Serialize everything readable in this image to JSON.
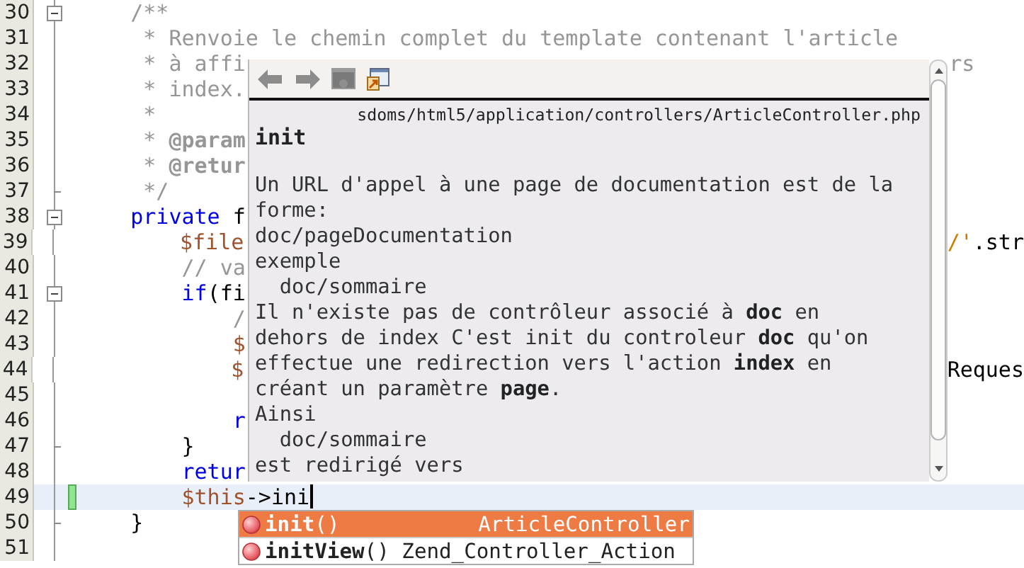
{
  "editor": {
    "lines": [
      {
        "number": "30",
        "fold_start": true,
        "fold_end": false,
        "changed": false,
        "current": false,
        "tokens": [
          {
            "text": "    /**",
            "kind": "comment"
          }
        ]
      },
      {
        "number": "31",
        "fold_start": false,
        "fold_end": false,
        "changed": false,
        "current": false,
        "tokens": [
          {
            "text": "     * Renvoie le chemin complet du template contenant l'article",
            "kind": "comment"
          }
        ]
      },
      {
        "number": "32",
        "fold_start": false,
        "fold_end": false,
        "changed": false,
        "current": false,
        "tokens": [
          {
            "text": "     * à affi",
            "kind": "comment"
          }
        ],
        "tail": [
          {
            "text": "rs",
            "kind": "comment"
          }
        ]
      },
      {
        "number": "33",
        "fold_start": false,
        "fold_end": false,
        "changed": false,
        "current": false,
        "tokens": [
          {
            "text": "     * index.",
            "kind": "comment"
          }
        ]
      },
      {
        "number": "34",
        "fold_start": false,
        "fold_end": false,
        "changed": false,
        "current": false,
        "tokens": [
          {
            "text": "     *",
            "kind": "comment"
          }
        ]
      },
      {
        "number": "35",
        "fold_start": false,
        "fold_end": false,
        "changed": false,
        "current": false,
        "tokens": [
          {
            "text": "     * ",
            "kind": "comment"
          },
          {
            "text": "@param",
            "kind": "doctag"
          }
        ]
      },
      {
        "number": "36",
        "fold_start": false,
        "fold_end": false,
        "changed": false,
        "current": false,
        "tokens": [
          {
            "text": "     * ",
            "kind": "comment"
          },
          {
            "text": "@retur",
            "kind": "doctag"
          }
        ]
      },
      {
        "number": "37",
        "fold_start": false,
        "fold_end": true,
        "changed": false,
        "current": false,
        "tokens": [
          {
            "text": "     */",
            "kind": "comment"
          }
        ]
      },
      {
        "number": "38",
        "fold_start": true,
        "fold_end": false,
        "changed": false,
        "current": false,
        "tokens": [
          {
            "text": "    private",
            "kind": "keyword"
          },
          {
            "text": " f",
            "kind": "plain"
          }
        ]
      },
      {
        "number": "39",
        "fold_start": false,
        "fold_end": false,
        "changed": false,
        "current": false,
        "tokens": [
          {
            "text": "        $file",
            "kind": "variable"
          }
        ],
        "tail": [
          {
            "text": "/'",
            "kind": "string"
          },
          {
            "text": ".str",
            "kind": "plain"
          }
        ]
      },
      {
        "number": "40",
        "fold_start": false,
        "fold_end": false,
        "changed": false,
        "current": false,
        "tokens": [
          {
            "text": "        // va",
            "kind": "comment"
          }
        ]
      },
      {
        "number": "41",
        "fold_start": true,
        "fold_end": false,
        "changed": false,
        "current": false,
        "tokens": [
          {
            "text": "        if",
            "kind": "keyword"
          },
          {
            "text": "(fi",
            "kind": "plain"
          }
        ]
      },
      {
        "number": "42",
        "fold_start": false,
        "fold_end": false,
        "changed": false,
        "current": false,
        "tokens": [
          {
            "text": "            /",
            "kind": "comment"
          }
        ]
      },
      {
        "number": "43",
        "fold_start": false,
        "fold_end": false,
        "changed": false,
        "current": false,
        "tokens": [
          {
            "text": "            $",
            "kind": "variable"
          }
        ]
      },
      {
        "number": "44",
        "fold_start": false,
        "fold_end": false,
        "changed": false,
        "current": false,
        "tokens": [
          {
            "text": "            $",
            "kind": "variable"
          }
        ],
        "tail": [
          {
            "text": "Reques",
            "kind": "plain"
          }
        ]
      },
      {
        "number": "45",
        "fold_start": false,
        "fold_end": false,
        "changed": false,
        "current": false
      },
      {
        "number": "46",
        "fold_start": false,
        "fold_end": false,
        "changed": false,
        "current": false,
        "tokens": [
          {
            "text": "            r",
            "kind": "keyword"
          }
        ]
      },
      {
        "number": "47",
        "fold_start": false,
        "fold_end": true,
        "changed": false,
        "current": false,
        "tokens": [
          {
            "text": "        }",
            "kind": "plain"
          }
        ]
      },
      {
        "number": "48",
        "fold_start": false,
        "fold_end": false,
        "changed": false,
        "current": false,
        "tokens": [
          {
            "text": "        retur",
            "kind": "keyword"
          }
        ]
      },
      {
        "number": "49",
        "fold_start": false,
        "fold_end": false,
        "changed": true,
        "current": true,
        "tokens": [
          {
            "text": "        $this",
            "kind": "variable"
          },
          {
            "text": "->ini",
            "kind": "plain"
          }
        ]
      },
      {
        "number": "50",
        "fold_start": false,
        "fold_end": true,
        "changed": false,
        "current": false,
        "tokens": [
          {
            "text": "    }",
            "kind": "plain"
          }
        ]
      },
      {
        "number": "51",
        "fold_start": false,
        "fold_end": false,
        "changed": false,
        "current": false
      }
    ]
  },
  "doc_popup": {
    "path": "sdoms/html5/application/controllers/ArticleController.php",
    "title": "init",
    "lines": [
      "Un URL d'appel à une page de documentation est de la",
      "forme:",
      "doc/pageDocumentation",
      "exemple",
      "  doc/sommaire",
      "Il n'existe pas de contrôleur associé à **doc** en",
      "dehors de index C'est init du controleur **doc** qu'on",
      "effectue une redirection vers l'action **index** en",
      "créant un paramètre **page**.",
      "Ainsi",
      "  doc/sommaire",
      "est redirigé vers"
    ]
  },
  "completion": {
    "items": [
      {
        "name": "**init**()",
        "type": "ArticleController",
        "selected": true
      },
      {
        "name": "**initView**()",
        "type": "Zend_Controller_Action",
        "selected": false
      }
    ]
  }
}
